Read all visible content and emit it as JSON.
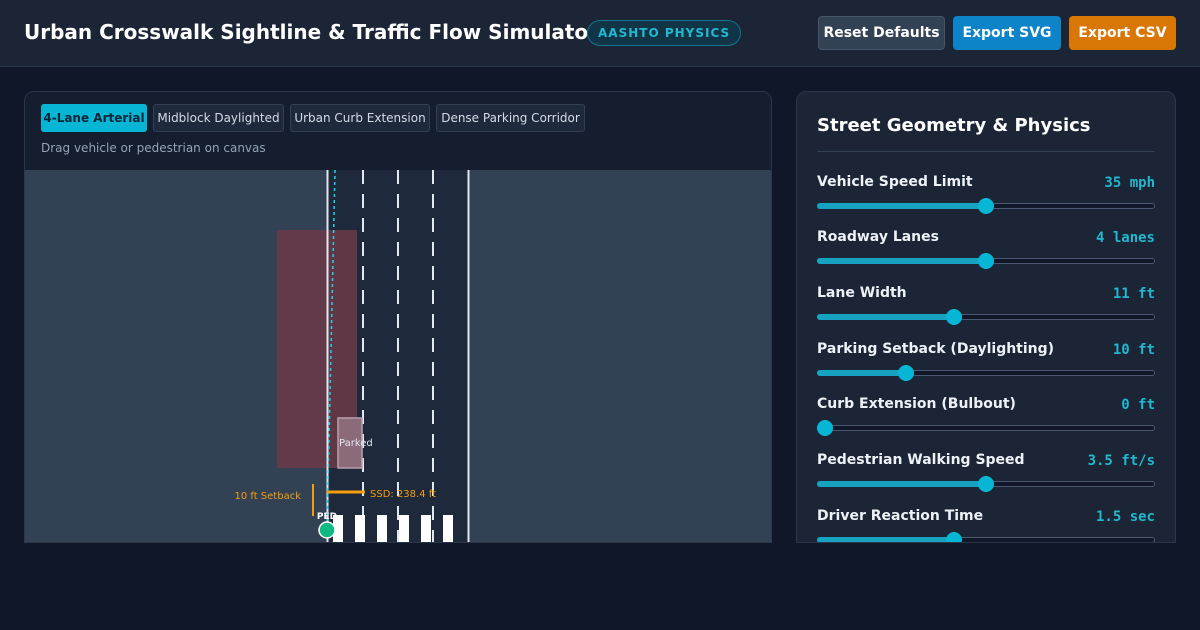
{
  "header": {
    "title": "Urban Crosswalk Sightline & Traffic Flow Simulator",
    "badge": "AASHTO PHYSICS",
    "buttons": {
      "reset": "Reset Defaults",
      "export_svg": "Export SVG",
      "export_csv": "Export CSV"
    }
  },
  "canvas_panel": {
    "presets": [
      {
        "label": "4-Lane Arterial",
        "active": true
      },
      {
        "label": "Midblock Daylighted",
        "active": false
      },
      {
        "label": "Urban Curb Extension",
        "active": false
      },
      {
        "label": "Dense Parking Corridor",
        "active": false
      }
    ],
    "hint": "Drag vehicle or pedestrian on canvas",
    "scene": {
      "parked_label": "Parked",
      "setback_label": "10 ft Setback",
      "ssd_label": "SSD: 238.4 ft",
      "ped_label": "PED"
    }
  },
  "controls": {
    "title": "Street Geometry & Physics",
    "params": [
      {
        "label": "Vehicle Speed Limit",
        "value": "35 mph",
        "level": 0.5
      },
      {
        "label": "Roadway Lanes",
        "value": "4 lanes",
        "level": 0.5
      },
      {
        "label": "Lane Width",
        "value": "11 ft",
        "level": 0.4
      },
      {
        "label": "Parking Setback (Daylighting)",
        "value": "10 ft",
        "level": 0.25
      },
      {
        "label": "Curb Extension (Bulbout)",
        "value": "0 ft",
        "level": 0.0
      },
      {
        "label": "Pedestrian Walking Speed",
        "value": "3.5 ft/s",
        "level": 0.5
      },
      {
        "label": "Driver Reaction Time",
        "value": "1.5 sec",
        "level": 0.4
      }
    ]
  },
  "colors": {
    "accent": "#06b6d4",
    "export_svg": "#0d84c7",
    "export_csv": "#d97706",
    "sightline_zone": "#6b3a48",
    "ssd_line": "#f59e0b",
    "pedestrian": "#10b981"
  }
}
